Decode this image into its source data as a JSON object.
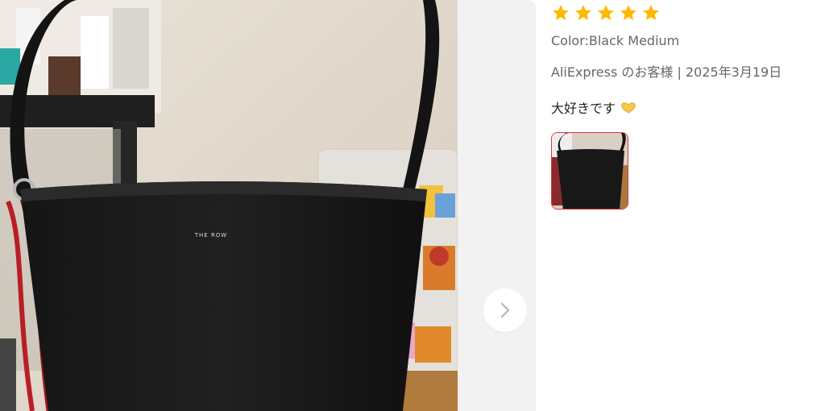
{
  "review": {
    "rating": 5,
    "color": "Color:Black Medium",
    "meta": "AliExpress のお客様 | 2025年3月19日",
    "text": "大好きです",
    "emoji_icon": "heart-hands-icon",
    "photo_label": "THE ROW"
  },
  "viewer": {
    "next_icon": "chevron-right-icon"
  },
  "colors": {
    "star": "#FFB800",
    "thumb_border": "#e0333a",
    "muted_text": "#666666"
  }
}
